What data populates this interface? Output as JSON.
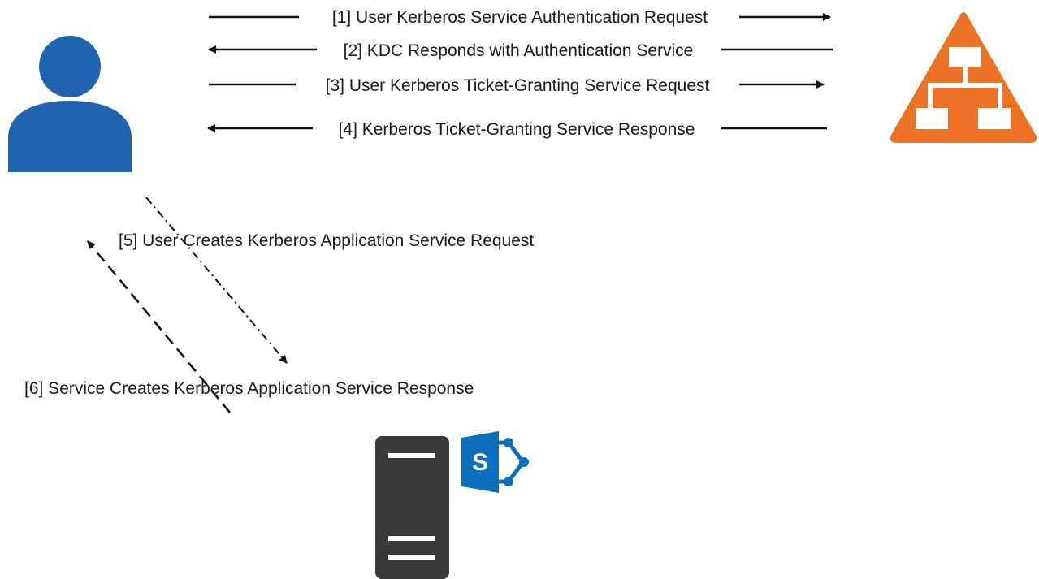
{
  "steps": [
    {
      "id": 1,
      "label": "[1] User Kerberos Service Authentication Request",
      "direction": "to-kdc",
      "line_style": "solid"
    },
    {
      "id": 2,
      "label": "[2] KDC Responds with Authentication Service",
      "direction": "to-user",
      "line_style": "solid"
    },
    {
      "id": 3,
      "label": "[3] User Kerberos Ticket-Granting Service Request",
      "direction": "to-kdc",
      "line_style": "solid"
    },
    {
      "id": 4,
      "label": "[4] Kerberos Ticket-Granting Service Response",
      "direction": "to-user",
      "line_style": "solid"
    },
    {
      "id": 5,
      "label": "[5] User Creates Kerberos Application Service Request",
      "direction": "to-server",
      "line_style": "dotted"
    },
    {
      "id": 6,
      "label": "[6] Service Creates Kerberos Application Service Response",
      "direction": "to-user",
      "line_style": "dashed"
    }
  ],
  "icons": {
    "user": "user-icon",
    "kdc": "kdc-hierarchy-icon",
    "server": "server-tower-icon",
    "app": "sharepoint-logo-icon"
  },
  "logo_letter": "S",
  "colors": {
    "user_blue": "#1f63ae",
    "kdc_orange": "#ec7326",
    "server_dark": "#3a3a3a",
    "sharepoint_blue": "#0a6ebd",
    "arrow": "#111111",
    "text": "#1a1a1a"
  }
}
